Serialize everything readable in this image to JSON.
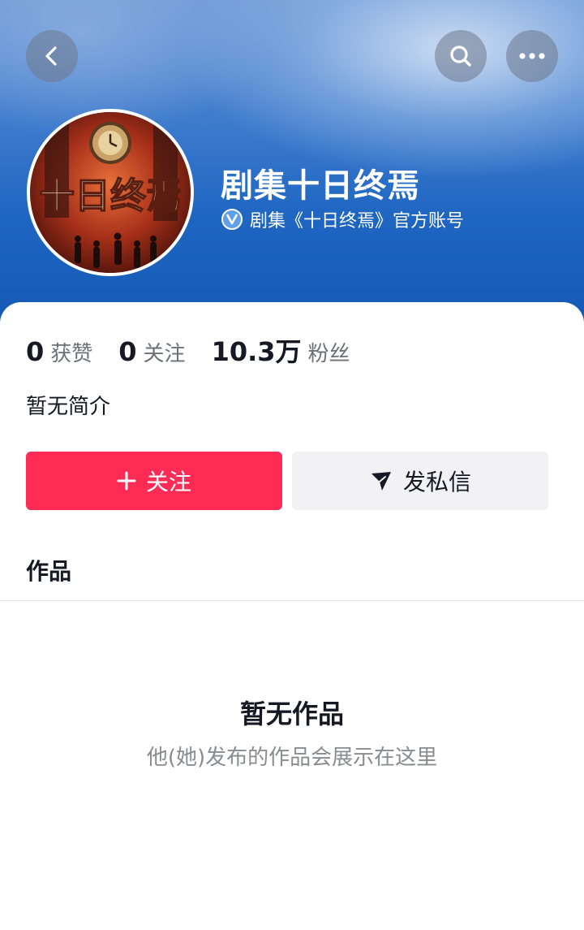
{
  "header": {
    "back_icon": "chevron-left-icon",
    "search_icon": "search-icon",
    "more_icon": "more-horizontal-icon"
  },
  "profile": {
    "name": "剧集十日终焉",
    "verified_text": "剧集《十日终焉》官方账号",
    "avatar_text": "十日终焉"
  },
  "stats": [
    {
      "value": "0",
      "label": "获赞"
    },
    {
      "value": "0",
      "label": "关注"
    },
    {
      "value": "10.3万",
      "label": "粉丝"
    }
  ],
  "bio": "暂无简介",
  "actions": {
    "follow_label": "关注",
    "message_label": "发私信"
  },
  "tabs": {
    "works_label": "作品"
  },
  "empty_state": {
    "title": "暂无作品",
    "subtitle": "他(她)发布的作品会展示在这里"
  },
  "colors": {
    "accent": "#fe2c55",
    "header_blue": "#1f66c2"
  }
}
